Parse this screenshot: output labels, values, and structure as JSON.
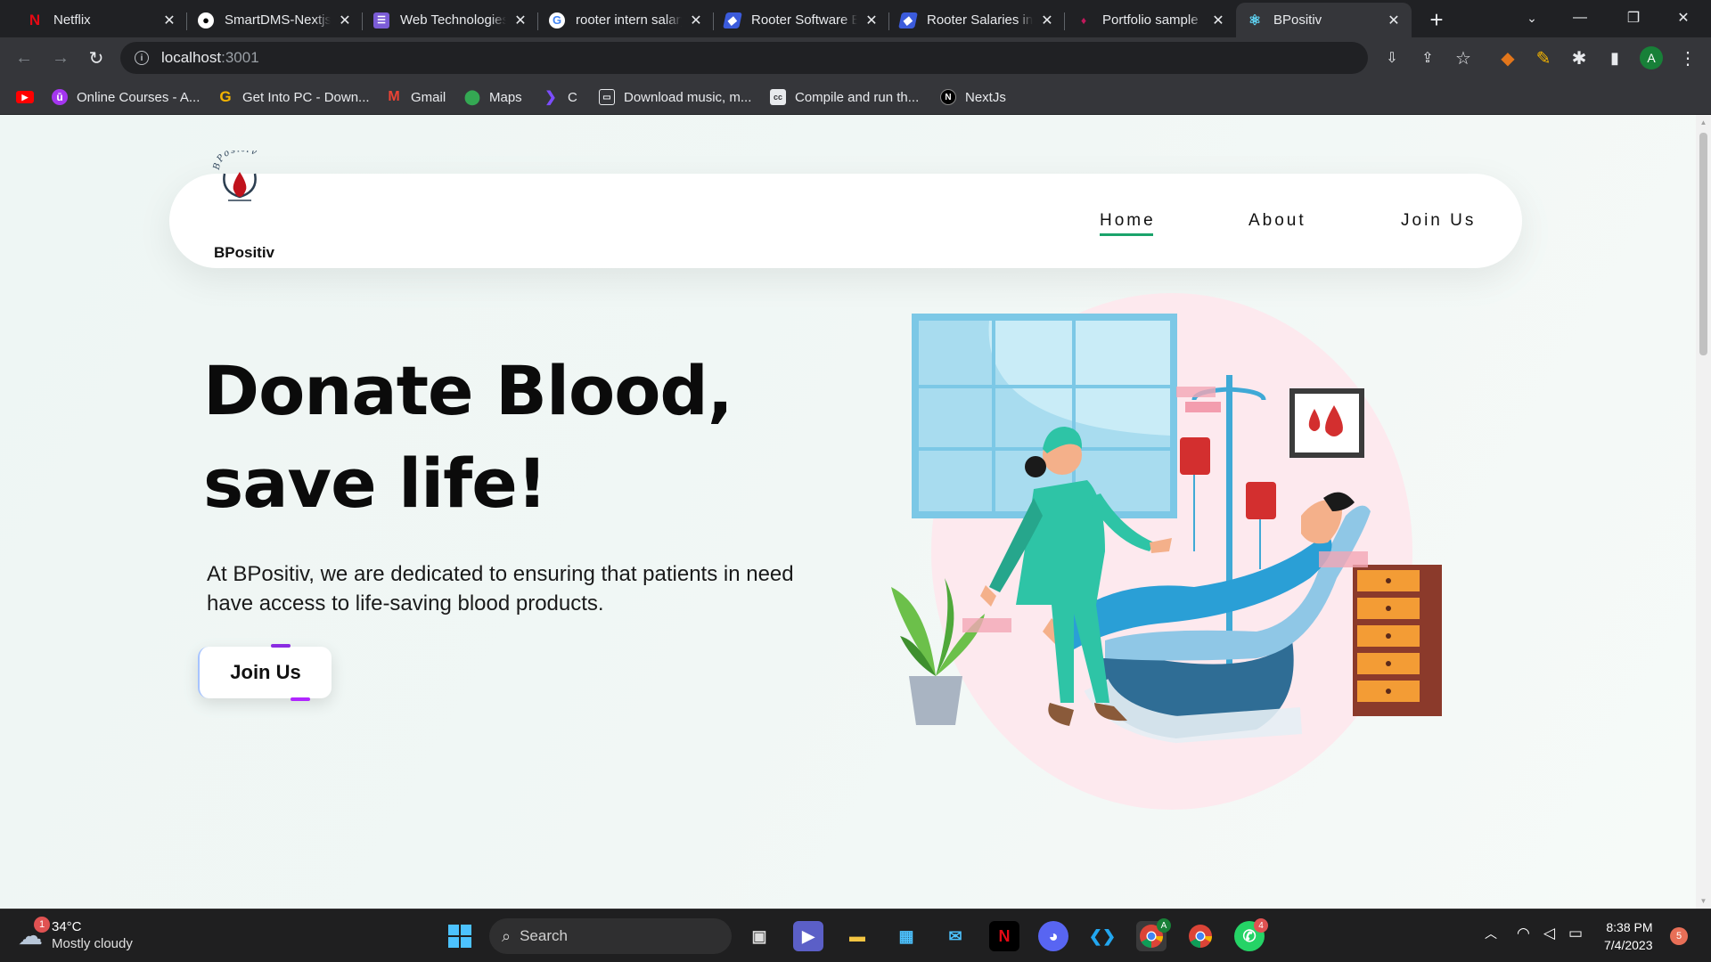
{
  "browser": {
    "tabs": [
      {
        "title": "Netflix",
        "icon": "netflix-icon"
      },
      {
        "title": "SmartDMS-Nextjs",
        "icon": "github-icon"
      },
      {
        "title": "Web Technologies",
        "icon": "list-icon"
      },
      {
        "title": "rooter intern salary",
        "icon": "google-icon"
      },
      {
        "title": "Rooter Software Engineer",
        "icon": "rooter-icon"
      },
      {
        "title": "Rooter Salaries in",
        "icon": "rooter-icon"
      },
      {
        "title": "Portfolio sample",
        "icon": "portfolio-icon"
      },
      {
        "title": "BPositiv",
        "icon": "react-icon",
        "active": true
      }
    ],
    "url_host": "localhost",
    "url_port": ":3001",
    "profile_initial": "A",
    "bookmarks": [
      {
        "label": "",
        "icon": "youtube-icon"
      },
      {
        "label": "Online Courses - A...",
        "icon": "udemy-icon"
      },
      {
        "label": "Get Into PC - Down...",
        "icon": "getintopc-icon"
      },
      {
        "label": "Gmail",
        "icon": "gmail-icon"
      },
      {
        "label": "Maps",
        "icon": "maps-icon"
      },
      {
        "label": "C",
        "icon": "c-icon"
      },
      {
        "label": "Download music, m...",
        "icon": "download-icon"
      },
      {
        "label": "Compile and run th...",
        "icon": "cc-icon"
      },
      {
        "label": "NextJs",
        "icon": "nextjs-icon"
      }
    ]
  },
  "site": {
    "brand": "BPositiv",
    "logo_arc_text": "BPositiv",
    "nav": [
      {
        "label": "Home",
        "active": true
      },
      {
        "label": "About",
        "active": false
      },
      {
        "label": "Join Us",
        "active": false
      }
    ],
    "hero": {
      "title_line1": "Donate Blood,",
      "title_line2": "save life!",
      "description": "At BPositiv, we are dedicated to ensuring that patients in need have access to life-saving blood products.",
      "cta": "Join Us"
    },
    "colors": {
      "accent_green": "#1aa36b",
      "blood_red": "#d32f2f",
      "teal": "#2ec4a6"
    }
  },
  "taskbar": {
    "weather_temp": "34°C",
    "weather_desc": "Mostly cloudy",
    "weather_badge": "1",
    "search_label": "Search",
    "time": "8:38 PM",
    "date": "7/4/2023",
    "notification_count": "5",
    "whatsapp_badge": "4",
    "chrome_profile_badge": "A"
  }
}
